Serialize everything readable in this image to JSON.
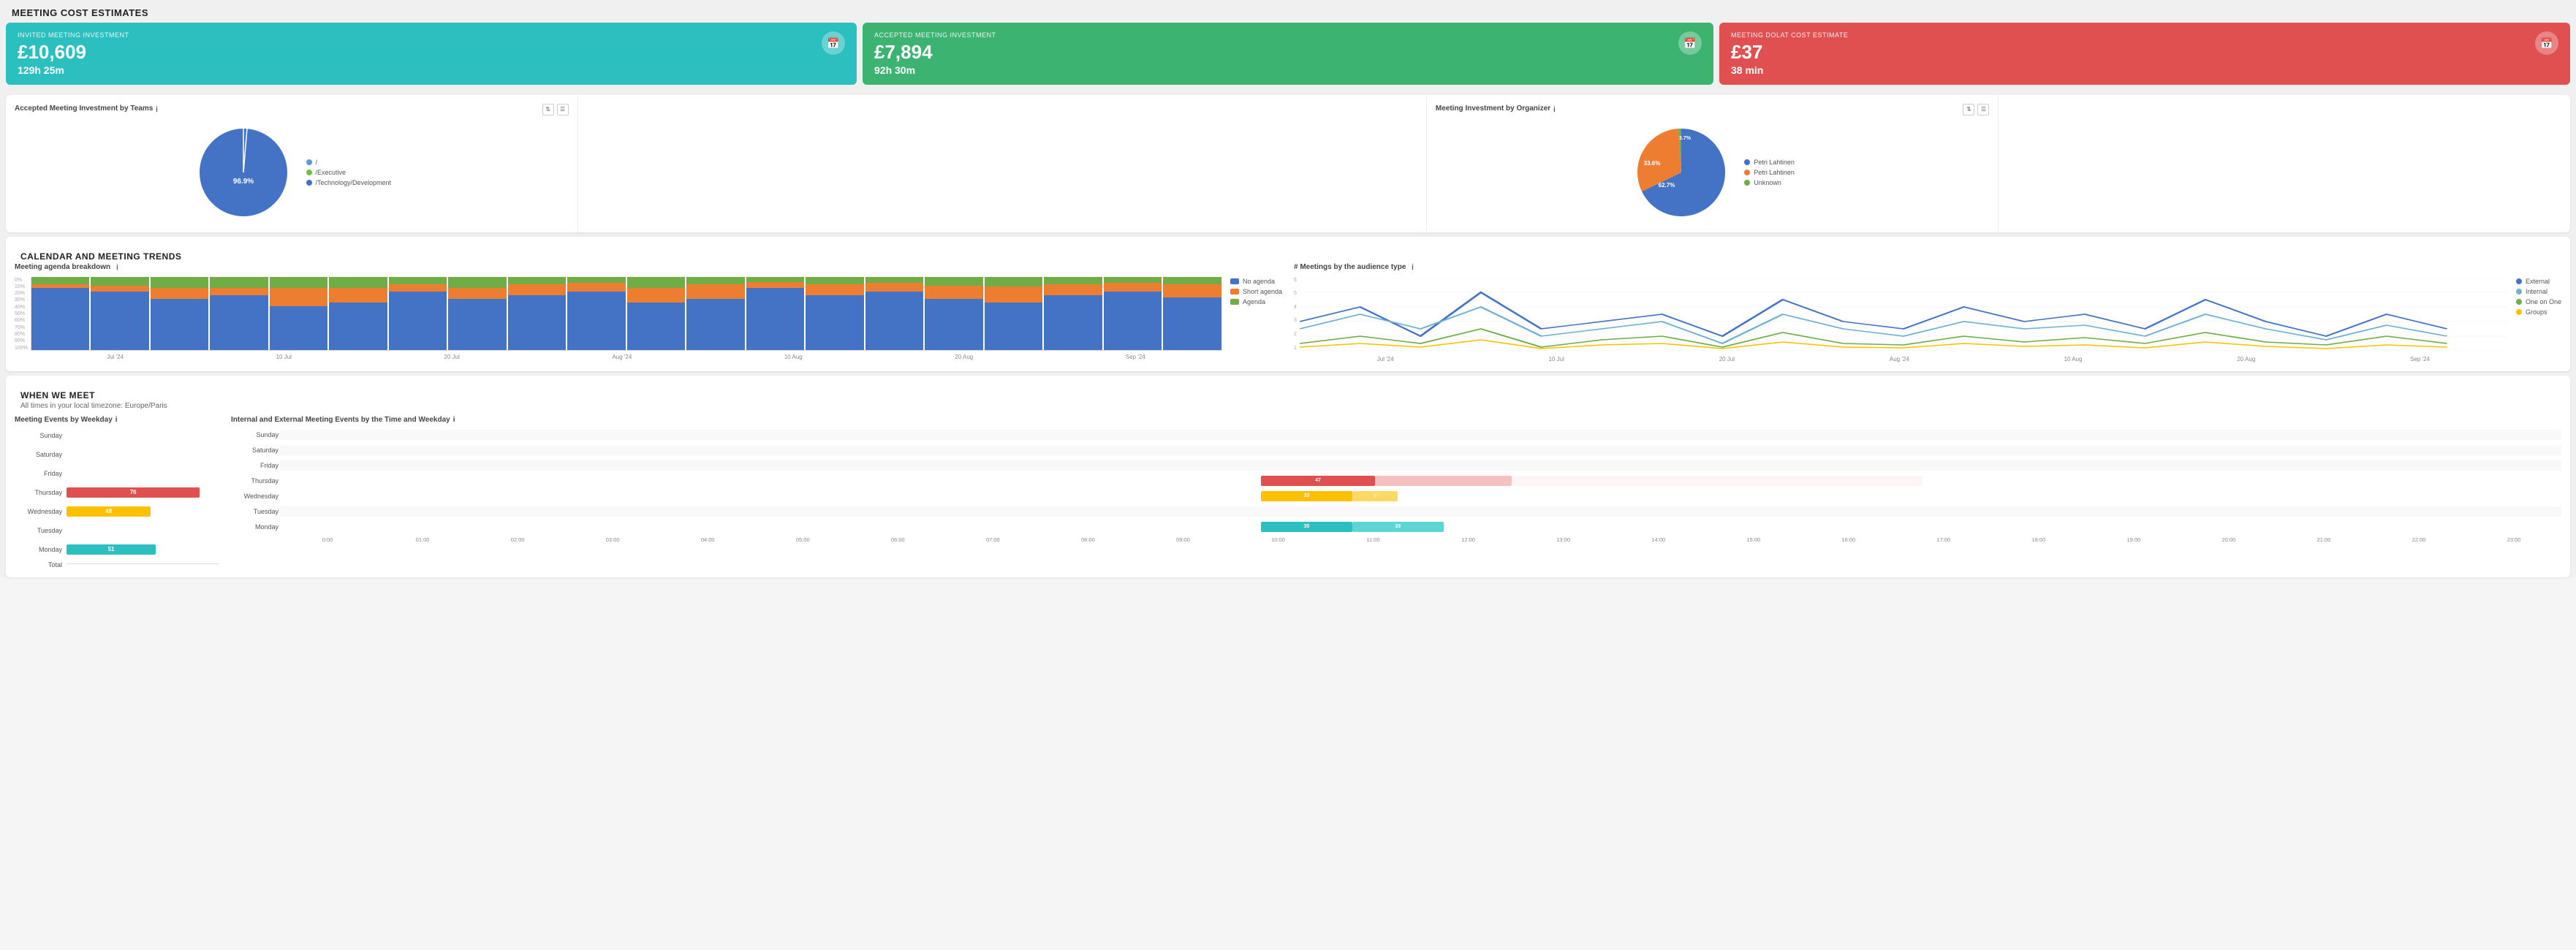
{
  "page": {
    "title": "MEETING COST ESTIMATES"
  },
  "kpis": [
    {
      "id": "invited",
      "label": "INVITED MEETING INVESTMENT",
      "value": "£10,609",
      "sub": "129h 25m",
      "color": "teal",
      "icon": "📅"
    },
    {
      "id": "accepted",
      "label": "ACCEPTED MEETING INVESTMENT",
      "value": "£7,894",
      "sub": "92h 30m",
      "color": "green",
      "icon": "📅"
    },
    {
      "id": "dolat",
      "label": "MEETING DOLAT COST ESTIMATE",
      "value": "£37",
      "sub": "38 min",
      "color": "red",
      "icon": "📅"
    }
  ],
  "acceptedByTeams": {
    "title": "Accepted Meeting Investment by Teams",
    "legend": [
      {
        "label": "/",
        "color": "#5b9bd5"
      },
      {
        "label": "/Executive",
        "color": "#70c040"
      },
      {
        "label": "/Technology/Development",
        "color": "#70c040"
      }
    ],
    "pieData": [
      {
        "label": "96.9%",
        "value": 96.9,
        "color": "#4472c4"
      }
    ]
  },
  "meetingByOrganizer": {
    "title": "Meeting Investment by Organizer",
    "legend": [
      {
        "label": "Petri Lahtinen",
        "color": "#4472c4"
      },
      {
        "label": "Petri Lahtinen",
        "color": "#4472c4"
      },
      {
        "label": "Unknown",
        "color": "#70ad47"
      }
    ],
    "segments": [
      {
        "label": "62.7%",
        "value": 62.7,
        "color": "#4472c4"
      },
      {
        "label": "33.6%",
        "value": 33.6,
        "color": "#ed7d31"
      },
      {
        "label": "3.7%",
        "value": 3.7,
        "color": "#70ad47"
      }
    ]
  },
  "calendarTrends": {
    "title": "CALENDAR AND MEETING TRENDS",
    "agendaBreakdown": {
      "title": "Meeting agenda breakdown",
      "legend": [
        {
          "label": "No agenda",
          "color": "#4472c4"
        },
        {
          "label": "Short agenda",
          "color": "#ed7d31"
        },
        {
          "label": "Agenda",
          "color": "#70ad47"
        }
      ],
      "yLabels": [
        "0%",
        "10%",
        "20%",
        "30%",
        "40%",
        "50%",
        "60%",
        "70%",
        "80%",
        "90%",
        "100%"
      ],
      "xLabels": [
        "Jul '24",
        "10 Jul",
        "20 Jul",
        "Aug '24",
        "10 Aug",
        "20 Aug",
        "Sep '24"
      ],
      "groups": [
        {
          "blue": 85,
          "orange": 5,
          "green": 10
        },
        {
          "blue": 80,
          "orange": 8,
          "green": 12
        },
        {
          "blue": 70,
          "orange": 15,
          "green": 15
        },
        {
          "blue": 75,
          "orange": 10,
          "green": 15
        },
        {
          "blue": 60,
          "orange": 25,
          "green": 15
        },
        {
          "blue": 65,
          "orange": 20,
          "green": 15
        },
        {
          "blue": 80,
          "orange": 10,
          "green": 10
        },
        {
          "blue": 70,
          "orange": 15,
          "green": 15
        },
        {
          "blue": 75,
          "orange": 15,
          "green": 10
        },
        {
          "blue": 80,
          "orange": 12,
          "green": 8
        },
        {
          "blue": 65,
          "orange": 20,
          "green": 15
        },
        {
          "blue": 70,
          "orange": 20,
          "green": 10
        },
        {
          "blue": 85,
          "orange": 8,
          "green": 7
        },
        {
          "blue": 75,
          "orange": 15,
          "green": 10
        },
        {
          "blue": 80,
          "orange": 12,
          "green": 8
        },
        {
          "blue": 70,
          "orange": 18,
          "green": 12
        },
        {
          "blue": 65,
          "orange": 22,
          "green": 13
        },
        {
          "blue": 75,
          "orange": 15,
          "green": 10
        },
        {
          "blue": 80,
          "orange": 12,
          "green": 8
        },
        {
          "blue": 72,
          "orange": 18,
          "green": 10
        }
      ]
    },
    "audienceType": {
      "title": "# Meetings by the audience type",
      "legend": [
        {
          "label": "External",
          "color": "#4472c4"
        },
        {
          "label": "Internal",
          "color": "#4472c4"
        },
        {
          "label": "One on One",
          "color": "#70ad47"
        },
        {
          "label": "Groups",
          "color": "#ffc000"
        }
      ],
      "yLabels": [
        "1",
        "2",
        "3",
        "4",
        "5",
        "6"
      ],
      "xLabels": [
        "Jul '24",
        "10 Jul",
        "20 Jul",
        "Aug '24",
        "10 Aug",
        "20 Aug",
        "Sep '24"
      ]
    }
  },
  "whenWeMeet": {
    "title": "WHEN WE MEET",
    "subtitle": "All times in your local timezone: Europe/Paris",
    "weekdayChart": {
      "title": "Meeting Events by Weekday",
      "rows": [
        {
          "label": "Sunday",
          "value": 0,
          "color": "#4472c4",
          "text": ""
        },
        {
          "label": "Saturday",
          "value": 0,
          "color": "#4472c4",
          "text": ""
        },
        {
          "label": "Friday",
          "value": 0,
          "color": "#4472c4",
          "text": ""
        },
        {
          "label": "Thursday",
          "value": 76,
          "color": "#e05050",
          "text": "76"
        },
        {
          "label": "Wednesday",
          "value": 48,
          "color": "#ffc000",
          "text": "48"
        },
        {
          "label": "Tuesday",
          "value": 0,
          "color": "#4472c4",
          "text": ""
        },
        {
          "label": "Monday",
          "value": 51,
          "color": "#2bbfbf",
          "text": "51"
        }
      ],
      "maxValue": 100,
      "xLabel": "Total"
    },
    "timeHeatmap": {
      "title": "Internal and External Meeting Events by the Time and Weekday",
      "rows": [
        {
          "label": "Sunday",
          "cells": []
        },
        {
          "label": "Saturday",
          "cells": []
        },
        {
          "label": "Friday",
          "cells": []
        },
        {
          "label": "Thursday",
          "cells": [
            {
              "time": "10:00",
              "value": 47,
              "color": "#e05050",
              "text": "47"
            },
            {
              "time": "11:00",
              "value": null,
              "color": "#f5c0c0",
              "text": ""
            }
          ]
        },
        {
          "label": "Wednesday",
          "cells": [
            {
              "time": "10:00",
              "value": 33,
              "color": "#ffc000",
              "text": "33"
            },
            {
              "time": "11:00",
              "value": 3,
              "color": "#ffd966",
              "text": "3"
            }
          ]
        },
        {
          "label": "Tuesday",
          "cells": []
        },
        {
          "label": "Monday",
          "cells": [
            {
              "time": "10:00",
              "value": 30,
              "color": "#2bbfbf",
              "text": "30"
            },
            {
              "time": "11:00",
              "value": 33,
              "color": "#5dd5d5",
              "text": "33"
            }
          ]
        }
      ],
      "xLabels": [
        "0:00",
        "01:00",
        "02:00",
        "03:00",
        "04:00",
        "05:00",
        "06:00",
        "07:00",
        "08:00",
        "09:00",
        "10:00",
        "11:00",
        "12:00",
        "13:00",
        "14:00",
        "15:00",
        "16:00",
        "17:00",
        "18:00",
        "19:00",
        "20:00",
        "21:00",
        "22:00",
        "23:00"
      ]
    }
  }
}
